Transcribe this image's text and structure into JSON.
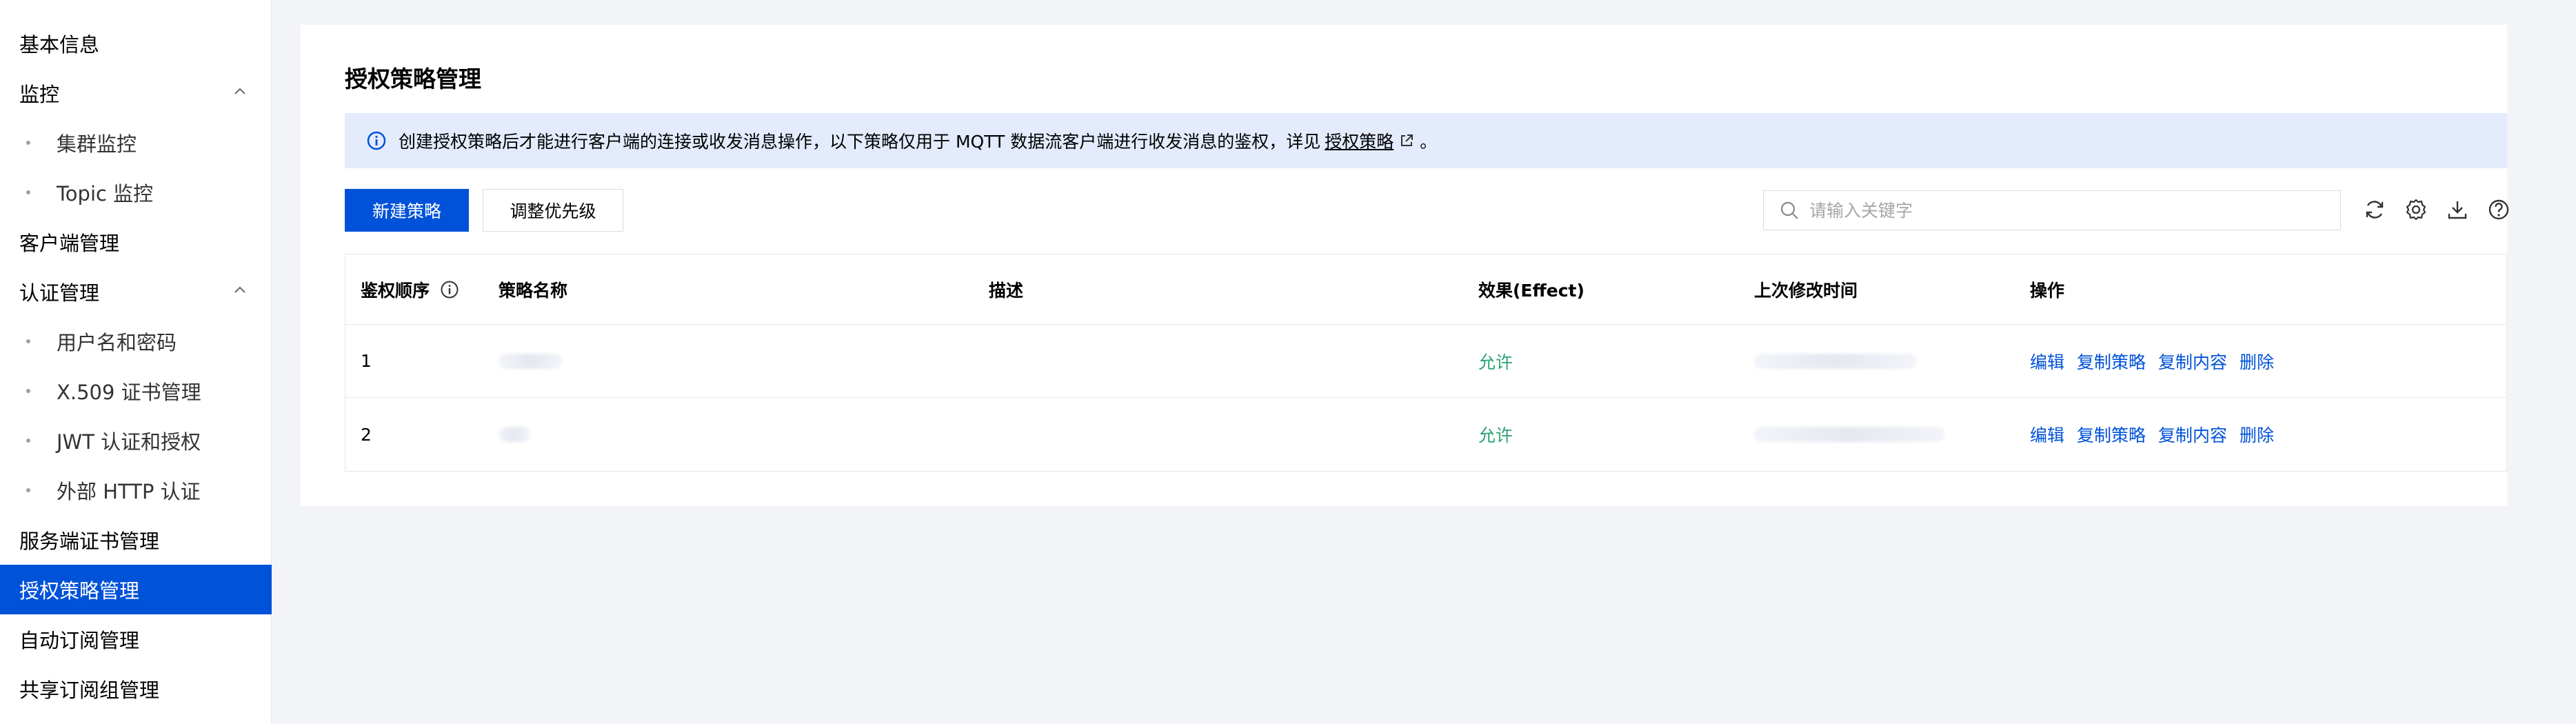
{
  "sidebar": {
    "items": [
      {
        "label": "基本信息"
      },
      {
        "label": "监控"
      },
      {
        "label": "集群监控"
      },
      {
        "label": "Topic 监控"
      },
      {
        "label": "客户端管理"
      },
      {
        "label": "认证管理"
      },
      {
        "label": "用户名和密码"
      },
      {
        "label": "X.509 证书管理"
      },
      {
        "label": "JWT 认证和授权"
      },
      {
        "label": "外部 HTTP 认证"
      },
      {
        "label": "服务端证书管理"
      },
      {
        "label": "授权策略管理"
      },
      {
        "label": "自动订阅管理"
      },
      {
        "label": "共享订阅组管理"
      }
    ],
    "active": "授权策略管理"
  },
  "page": {
    "title": "授权策略管理",
    "notice_text": "创建授权策略后才能进行客户端的连接或收发消息操作，以下策略仅用于 MQTT 数据流客户端进行收发消息的鉴权，详见",
    "notice_link": "授权策略",
    "notice_suffix": "。"
  },
  "toolbar": {
    "new_label": "新建策略",
    "priority_label": "调整优先级",
    "search_placeholder": "请输入关键字"
  },
  "table": {
    "columns": {
      "order": "鉴权顺序",
      "name": "策略名称",
      "desc": "描述",
      "effect": "效果(Effect)",
      "time": "上次修改时间",
      "ops": "操作"
    },
    "rows": [
      {
        "order": "1",
        "effect": "允许"
      },
      {
        "order": "2",
        "effect": "允许"
      }
    ],
    "actions": {
      "edit": "编辑",
      "copy_policy": "复制策略",
      "copy_content": "复制内容",
      "delete": "删除"
    }
  },
  "colors": {
    "primary": "#0052d9",
    "success": "#2ba471",
    "notice_bg": "#e3ebfc",
    "page_bg": "#f3f4f7"
  }
}
